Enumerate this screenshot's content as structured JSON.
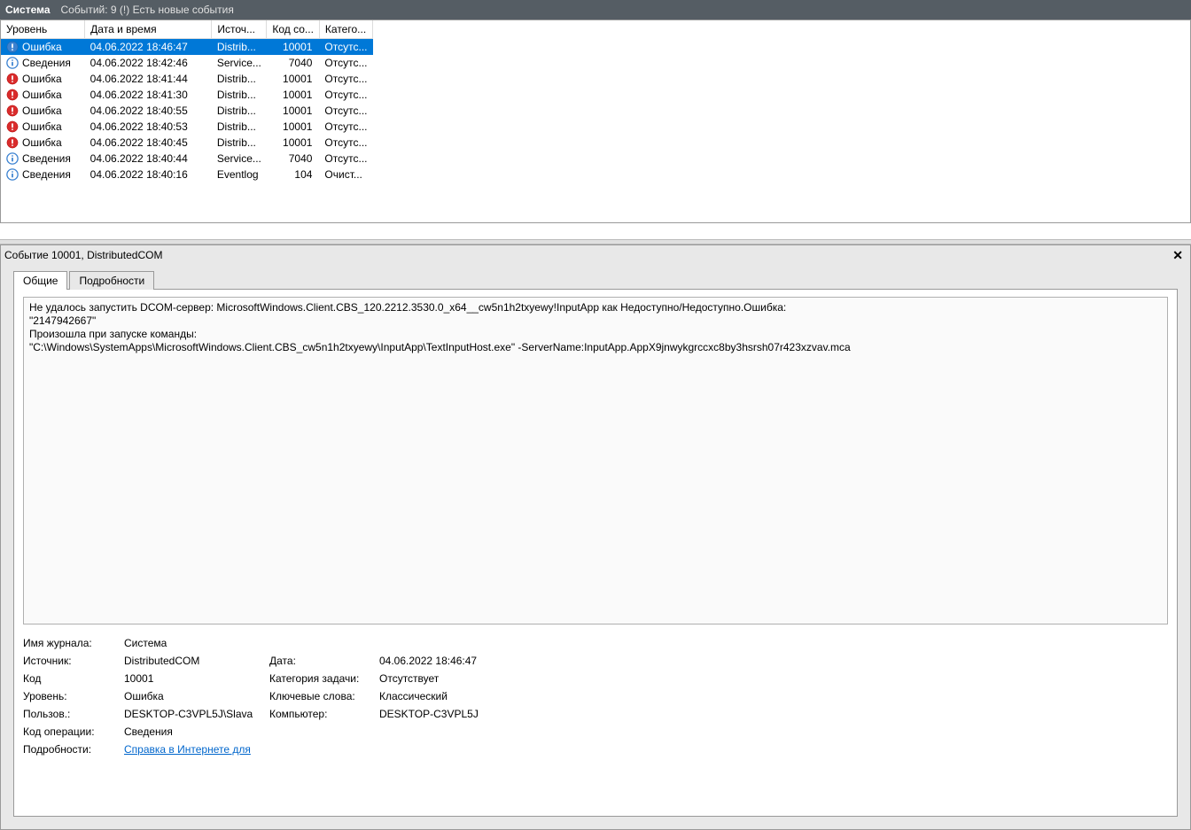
{
  "titlebar": {
    "title": "Система",
    "status": "Событий: 9 (!) Есть новые события"
  },
  "columns": {
    "level": "Уровень",
    "datetime": "Дата и время",
    "source": "Источ...",
    "code": "Код со...",
    "category": "Катего..."
  },
  "rows": [
    {
      "icon": "error-blue",
      "level": "Ошибка",
      "dt": "04.06.2022 18:46:47",
      "src": "Distrib...",
      "code": "10001",
      "cat": "Отсутс...",
      "selected": true
    },
    {
      "icon": "info",
      "level": "Сведения",
      "dt": "04.06.2022 18:42:46",
      "src": "Service...",
      "code": "7040",
      "cat": "Отсутс..."
    },
    {
      "icon": "error",
      "level": "Ошибка",
      "dt": "04.06.2022 18:41:44",
      "src": "Distrib...",
      "code": "10001",
      "cat": "Отсутс..."
    },
    {
      "icon": "error",
      "level": "Ошибка",
      "dt": "04.06.2022 18:41:30",
      "src": "Distrib...",
      "code": "10001",
      "cat": "Отсутс..."
    },
    {
      "icon": "error",
      "level": "Ошибка",
      "dt": "04.06.2022 18:40:55",
      "src": "Distrib...",
      "code": "10001",
      "cat": "Отсутс..."
    },
    {
      "icon": "error",
      "level": "Ошибка",
      "dt": "04.06.2022 18:40:53",
      "src": "Distrib...",
      "code": "10001",
      "cat": "Отсутс..."
    },
    {
      "icon": "error",
      "level": "Ошибка",
      "dt": "04.06.2022 18:40:45",
      "src": "Distrib...",
      "code": "10001",
      "cat": "Отсутс..."
    },
    {
      "icon": "info",
      "level": "Сведения",
      "dt": "04.06.2022 18:40:44",
      "src": "Service...",
      "code": "7040",
      "cat": "Отсутс..."
    },
    {
      "icon": "info",
      "level": "Сведения",
      "dt": "04.06.2022 18:40:16",
      "src": "Eventlog",
      "code": "104",
      "cat": "Очист..."
    }
  ],
  "detail": {
    "header": "Событие 10001, DistributedCOM",
    "tab_general": "Общие",
    "tab_details": "Подробности",
    "message": "Не удалось запустить DCOM-сервер: MicrosoftWindows.Client.CBS_120.2212.3530.0_x64__cw5n1h2txyewy!InputApp как Недоступно/Недоступно.Ошибка:\n\"2147942667\"\nПроизошла при запуске команды:\n\"C:\\Windows\\SystemApps\\MicrosoftWindows.Client.CBS_cw5n1h2txyewy\\InputApp\\TextInputHost.exe\" -ServerName:InputApp.AppX9jnwykgrccxc8by3hsrsh07r423xzvav.mca",
    "labels": {
      "log_name": "Имя журнала:",
      "source": "Источник:",
      "date": "Дата:",
      "code": "Код",
      "task_category": "Категория задачи:",
      "level": "Уровень:",
      "keywords": "Ключевые слова:",
      "user": "Пользов.:",
      "computer": "Компьютер:",
      "opcode": "Код операции:",
      "more_info": "Подробности:"
    },
    "values": {
      "log_name": "Система",
      "source": "DistributedCOM",
      "date": "04.06.2022 18:46:47",
      "code": "10001",
      "task_category": "Отсутствует",
      "level": "Ошибка",
      "keywords": "Классический",
      "user": "DESKTOP-C3VPL5J\\Slava",
      "computer": "DESKTOP-C3VPL5J",
      "opcode": "Сведения",
      "help_link": "Справка в Интернете для "
    }
  }
}
